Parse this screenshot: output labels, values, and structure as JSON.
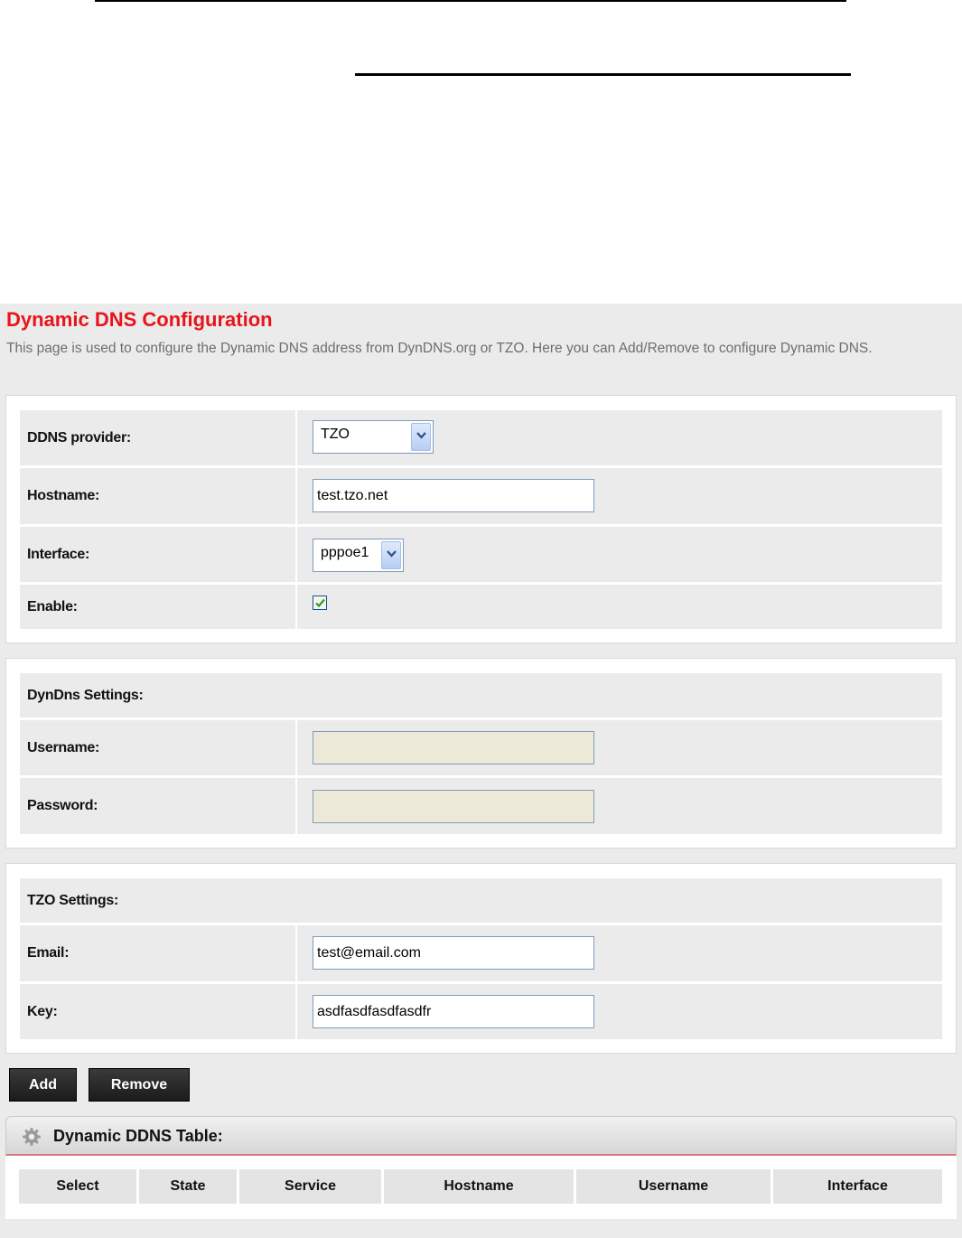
{
  "page": {
    "title": "Dynamic DNS Configuration",
    "description": "This page is used to configure the Dynamic DNS address from DynDNS.org or TZO. Here you can Add/Remove to configure Dynamic DNS."
  },
  "main_settings": {
    "provider_label": "DDNS provider:",
    "provider_value": "TZO",
    "hostname_label": "Hostname:",
    "hostname_value": "test.tzo.net",
    "interface_label": "Interface:",
    "interface_value": "pppoe1",
    "enable_label": "Enable:",
    "enable_checked": true
  },
  "dyndns": {
    "section_label": "DynDns Settings:",
    "username_label": "Username:",
    "username_value": "",
    "password_label": "Password:",
    "password_value": ""
  },
  "tzo": {
    "section_label": "TZO Settings:",
    "email_label": "Email:",
    "email_value": "test@email.com",
    "key_label": "Key:",
    "key_value": "asdfasdfasdfasdfr"
  },
  "buttons": {
    "add": "Add",
    "remove": "Remove"
  },
  "table": {
    "title": "Dynamic DDNS Table:",
    "columns": [
      "Select",
      "State",
      "Service",
      "Hostname",
      "Username",
      "Interface"
    ]
  },
  "colors": {
    "title_red": "#e8141b",
    "row_bg": "#ebebeb",
    "button_bg": "#1b1b1b",
    "disabled_input_bg": "#ece9d8"
  }
}
